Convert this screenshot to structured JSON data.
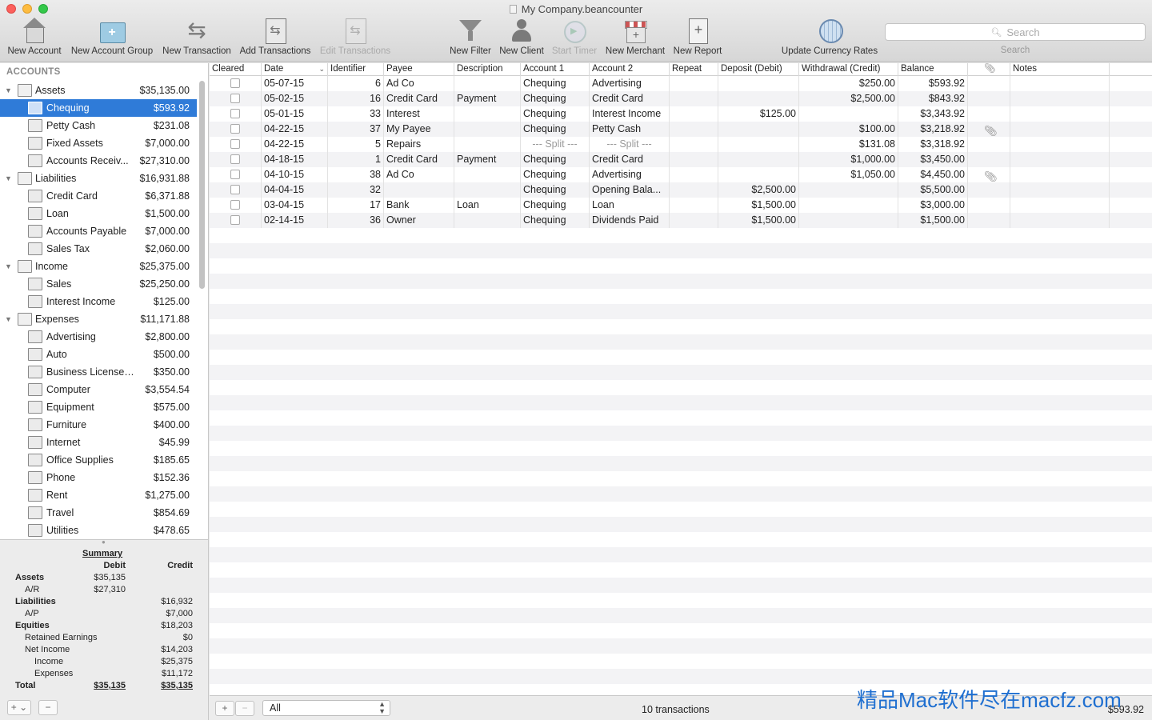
{
  "window": {
    "title": "My Company.beancounter"
  },
  "toolbar": {
    "items": [
      {
        "label": "New Account",
        "icon": "house-icon"
      },
      {
        "label": "New Account Group",
        "icon": "folder-plus-icon"
      },
      {
        "label": "New Transaction",
        "icon": "arrows-icon"
      },
      {
        "label": "Add Transactions",
        "icon": "document-arrows-icon"
      },
      {
        "label": "Edit Transactions",
        "icon": "document-arrows-icon",
        "disabled": true
      },
      {
        "label": "New Filter",
        "icon": "funnel-icon"
      },
      {
        "label": "New Client",
        "icon": "person-icon"
      },
      {
        "label": "Start Timer",
        "icon": "timer-icon",
        "disabled": true
      },
      {
        "label": "New Merchant",
        "icon": "shop-icon"
      },
      {
        "label": "New Report",
        "icon": "report-icon"
      },
      {
        "label": "Update Currency Rates",
        "icon": "globe-icon"
      }
    ],
    "search_placeholder": "Search",
    "search_label": "Search"
  },
  "sidebar": {
    "header": "ACCOUNTS",
    "accounts": [
      {
        "name": "Assets",
        "value": "$35,135.00",
        "level": 0
      },
      {
        "name": "Chequing",
        "value": "$593.92",
        "level": 1,
        "selected": true
      },
      {
        "name": "Petty Cash",
        "value": "$231.08",
        "level": 1
      },
      {
        "name": "Fixed Assets",
        "value": "$7,000.00",
        "level": 1
      },
      {
        "name": "Accounts Receiv...",
        "value": "$27,310.00",
        "level": 1
      },
      {
        "name": "Liabilities",
        "value": "$16,931.88",
        "level": 0
      },
      {
        "name": "Credit Card",
        "value": "$6,371.88",
        "level": 1
      },
      {
        "name": "Loan",
        "value": "$1,500.00",
        "level": 1
      },
      {
        "name": "Accounts Payable",
        "value": "$7,000.00",
        "level": 1
      },
      {
        "name": "Sales Tax",
        "value": "$2,060.00",
        "level": 1
      },
      {
        "name": "Income",
        "value": "$25,375.00",
        "level": 0
      },
      {
        "name": "Sales",
        "value": "$25,250.00",
        "level": 1
      },
      {
        "name": "Interest Income",
        "value": "$125.00",
        "level": 1
      },
      {
        "name": "Expenses",
        "value": "$11,171.88",
        "level": 0
      },
      {
        "name": "Advertising",
        "value": "$2,800.00",
        "level": 1
      },
      {
        "name": "Auto",
        "value": "$500.00",
        "level": 1
      },
      {
        "name": "Business Licenses/...",
        "value": "$350.00",
        "level": 1
      },
      {
        "name": "Computer",
        "value": "$3,554.54",
        "level": 1
      },
      {
        "name": "Equipment",
        "value": "$575.00",
        "level": 1
      },
      {
        "name": "Furniture",
        "value": "$400.00",
        "level": 1
      },
      {
        "name": "Internet",
        "value": "$45.99",
        "level": 1
      },
      {
        "name": "Office Supplies",
        "value": "$185.65",
        "level": 1
      },
      {
        "name": "Phone",
        "value": "$152.36",
        "level": 1
      },
      {
        "name": "Rent",
        "value": "$1,275.00",
        "level": 1
      },
      {
        "name": "Travel",
        "value": "$854.69",
        "level": 1
      },
      {
        "name": "Utilities",
        "value": "$478.65",
        "level": 1
      }
    ]
  },
  "summary": {
    "title": "Summary",
    "debit_header": "Debit",
    "credit_header": "Credit",
    "rows": [
      {
        "label": "Assets",
        "debit": "$35,135",
        "credit": "",
        "bold": true,
        "indent": 0
      },
      {
        "label": "A/R",
        "debit": "$27,310",
        "credit": "",
        "indent": 1
      },
      {
        "label": "Liabilities",
        "debit": "",
        "credit": "$16,932",
        "bold": true,
        "indent": 0
      },
      {
        "label": "A/P",
        "debit": "",
        "credit": "$7,000",
        "indent": 1
      },
      {
        "label": "Equities",
        "debit": "",
        "credit": "$18,203",
        "bold": true,
        "indent": 0
      },
      {
        "label": "Retained Earnings",
        "debit": "",
        "credit": "$0",
        "indent": 1
      },
      {
        "label": "Net Income",
        "debit": "",
        "credit": "$14,203",
        "indent": 1
      },
      {
        "label": "Income",
        "debit": "",
        "credit": "$25,375",
        "indent": 2
      },
      {
        "label": "Expenses",
        "debit": "",
        "credit": "$11,172",
        "indent": 2
      },
      {
        "label": "Total",
        "debit": "$35,135",
        "credit": "$35,135",
        "bold": true,
        "indent": 0,
        "total": true
      }
    ]
  },
  "table": {
    "columns": [
      "Cleared",
      "Date",
      "Identifier",
      "Payee",
      "Description",
      "Account 1",
      "Account 2",
      "Repeat",
      "Deposit (Debit)",
      "Withdrawal (Credit)",
      "Balance",
      "",
      "Notes"
    ],
    "rows": [
      {
        "date": "05-07-15",
        "id": "6",
        "payee": "Ad Co",
        "desc": "",
        "acct1": "Chequing",
        "acct2": "Advertising",
        "repeat": "",
        "deposit": "",
        "withdrawal": "$250.00",
        "balance": "$593.92",
        "attach": false,
        "notes": ""
      },
      {
        "date": "05-02-15",
        "id": "16",
        "payee": "Credit Card",
        "desc": "Payment",
        "acct1": "Chequing",
        "acct2": "Credit Card",
        "repeat": "",
        "deposit": "",
        "withdrawal": "$2,500.00",
        "balance": "$843.92",
        "attach": false,
        "notes": ""
      },
      {
        "date": "05-01-15",
        "id": "33",
        "payee": "Interest",
        "desc": "",
        "acct1": "Chequing",
        "acct2": "Interest Income",
        "repeat": "",
        "deposit": "$125.00",
        "withdrawal": "",
        "balance": "$3,343.92",
        "attach": false,
        "notes": ""
      },
      {
        "date": "04-22-15",
        "id": "37",
        "payee": "My Payee",
        "desc": "",
        "acct1": "Chequing",
        "acct2": "Petty Cash",
        "repeat": "",
        "deposit": "",
        "withdrawal": "$100.00",
        "balance": "$3,218.92",
        "attach": true,
        "notes": ""
      },
      {
        "date": "04-22-15",
        "id": "5",
        "payee": "Repairs",
        "desc": "",
        "acct1": "--- Split ---",
        "acct2": "--- Split ---",
        "split": true,
        "repeat": "",
        "deposit": "",
        "withdrawal": "$131.08",
        "balance": "$3,318.92",
        "attach": false,
        "notes": ""
      },
      {
        "date": "04-18-15",
        "id": "1",
        "payee": "Credit Card",
        "desc": "Payment",
        "acct1": "Chequing",
        "acct2": "Credit Card",
        "repeat": "",
        "deposit": "",
        "withdrawal": "$1,000.00",
        "balance": "$3,450.00",
        "attach": false,
        "notes": ""
      },
      {
        "date": "04-10-15",
        "id": "38",
        "payee": "Ad Co",
        "desc": "",
        "acct1": "Chequing",
        "acct2": "Advertising",
        "repeat": "",
        "deposit": "",
        "withdrawal": "$1,050.00",
        "balance": "$4,450.00",
        "attach": true,
        "notes": ""
      },
      {
        "date": "04-04-15",
        "id": "32",
        "payee": "",
        "desc": "",
        "acct1": "Chequing",
        "acct2": "Opening Bala...",
        "repeat": "",
        "deposit": "$2,500.00",
        "withdrawal": "",
        "balance": "$5,500.00",
        "attach": false,
        "notes": ""
      },
      {
        "date": "03-04-15",
        "id": "17",
        "payee": "Bank",
        "desc": "Loan",
        "acct1": "Chequing",
        "acct2": "Loan",
        "repeat": "",
        "deposit": "$1,500.00",
        "withdrawal": "",
        "balance": "$3,000.00",
        "attach": false,
        "notes": ""
      },
      {
        "date": "02-14-15",
        "id": "36",
        "payee": "Owner",
        "desc": "",
        "acct1": "Chequing",
        "acct2": "Dividends Paid",
        "repeat": "",
        "deposit": "$1,500.00",
        "withdrawal": "",
        "balance": "$1,500.00",
        "attach": false,
        "notes": ""
      }
    ]
  },
  "bottom": {
    "add_label": "+",
    "remove_label": "−",
    "filter_value": "All",
    "count_text": "10 transactions",
    "balance_text": "$593.92"
  },
  "sidebar_footer": {
    "add_label": "+ ⌄",
    "remove_label": "−"
  },
  "watermark": "精品Mac软件尽在macfz.com",
  "colors": {
    "selection": "#2f7bd8",
    "watermark": "#1f6fd0"
  }
}
